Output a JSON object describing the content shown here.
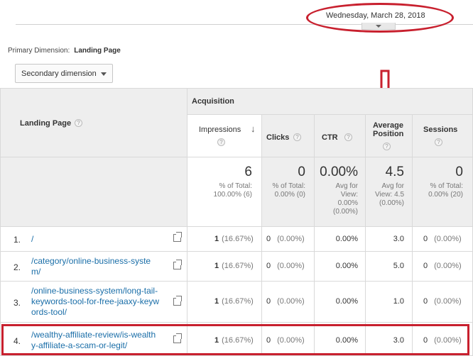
{
  "date_picker": {
    "date_text": "Wednesday, March 28, 2018"
  },
  "primary_dimension": {
    "label": "Primary Dimension:",
    "value": "Landing Page"
  },
  "secondary_dimension": {
    "label": "Secondary dimension"
  },
  "table": {
    "landing_page_header": "Landing Page",
    "group_header": "Acquisition",
    "columns": {
      "impressions": "Impressions",
      "clicks": "Clicks",
      "ctr": "CTR",
      "avg_position_line1": "Average",
      "avg_position_line2": "Position",
      "sessions": "Sessions"
    },
    "totals": {
      "impressions": {
        "value": "6",
        "sub1": "% of Total:",
        "sub2": "100.00% (6)"
      },
      "clicks": {
        "value": "0",
        "sub1": "% of Total:",
        "sub2": "0.00% (0)"
      },
      "ctr": {
        "value": "0.00%",
        "sub1": "Avg for",
        "sub2": "View:",
        "sub3": "0.00%",
        "sub4": "(0.00%)"
      },
      "avg_position": {
        "value": "4.5",
        "sub1": "Avg for",
        "sub2": "View: 4.5",
        "sub3": "(0.00%)"
      },
      "sessions": {
        "value": "0",
        "sub1": "% of Total:",
        "sub2": "0.00% (20)"
      }
    },
    "rows": [
      {
        "num": "1.",
        "page_lines": [
          "/"
        ],
        "impressions": "1",
        "impressions_pct": "(16.67%)",
        "clicks": "0",
        "clicks_pct": "(0.00%)",
        "ctr": "0.00%",
        "avg_position": "3.0",
        "sessions": "0",
        "sessions_pct": "(0.00%)"
      },
      {
        "num": "2.",
        "page_lines": [
          "/category/online-business-syste",
          "m/"
        ],
        "impressions": "1",
        "impressions_pct": "(16.67%)",
        "clicks": "0",
        "clicks_pct": "(0.00%)",
        "ctr": "0.00%",
        "avg_position": "5.0",
        "sessions": "0",
        "sessions_pct": "(0.00%)"
      },
      {
        "num": "3.",
        "page_lines": [
          "/online-business-system/long-tail-",
          "keywords-tool-for-free-jaaxy-keyw",
          "ords-tool/"
        ],
        "impressions": "1",
        "impressions_pct": "(16.67%)",
        "clicks": "0",
        "clicks_pct": "(0.00%)",
        "ctr": "0.00%",
        "avg_position": "1.0",
        "sessions": "0",
        "sessions_pct": "(0.00%)"
      },
      {
        "num": "4.",
        "page_lines": [
          "/wealthy-affiliate-review/is-wealth",
          "y-affiliate-a-scam-or-legit/"
        ],
        "impressions": "1",
        "impressions_pct": "(16.67%)",
        "clicks": "0",
        "clicks_pct": "(0.00%)",
        "ctr": "0.00%",
        "avg_position": "3.0",
        "sessions": "0",
        "sessions_pct": "(0.00%)"
      }
    ]
  },
  "annotation_color": "#c8202e",
  "link_color": "#1a6ea8"
}
